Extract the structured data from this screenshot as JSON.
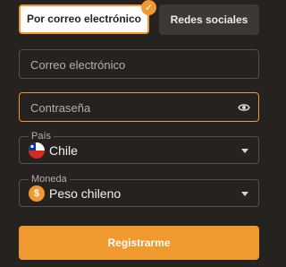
{
  "tabs": {
    "email_label": "Por correo electrónico",
    "social_label": "Redes sociales"
  },
  "form": {
    "email_placeholder": "Correo electrónico",
    "password_placeholder": "Contraseña",
    "country_label": "País",
    "country_value": "Chile",
    "currency_label": "Moneda",
    "currency_value": "Peso chileno",
    "submit_label": "Registrarme"
  },
  "icons": {
    "selected_tab_badge": "check-icon",
    "password_toggle": "eye-icon",
    "country_flag": "chile-flag-icon",
    "currency_symbol": "$"
  },
  "colors": {
    "accent": "#f0992e",
    "background": "#262220",
    "field_border": "#555049",
    "placeholder": "#b6b0aa"
  }
}
